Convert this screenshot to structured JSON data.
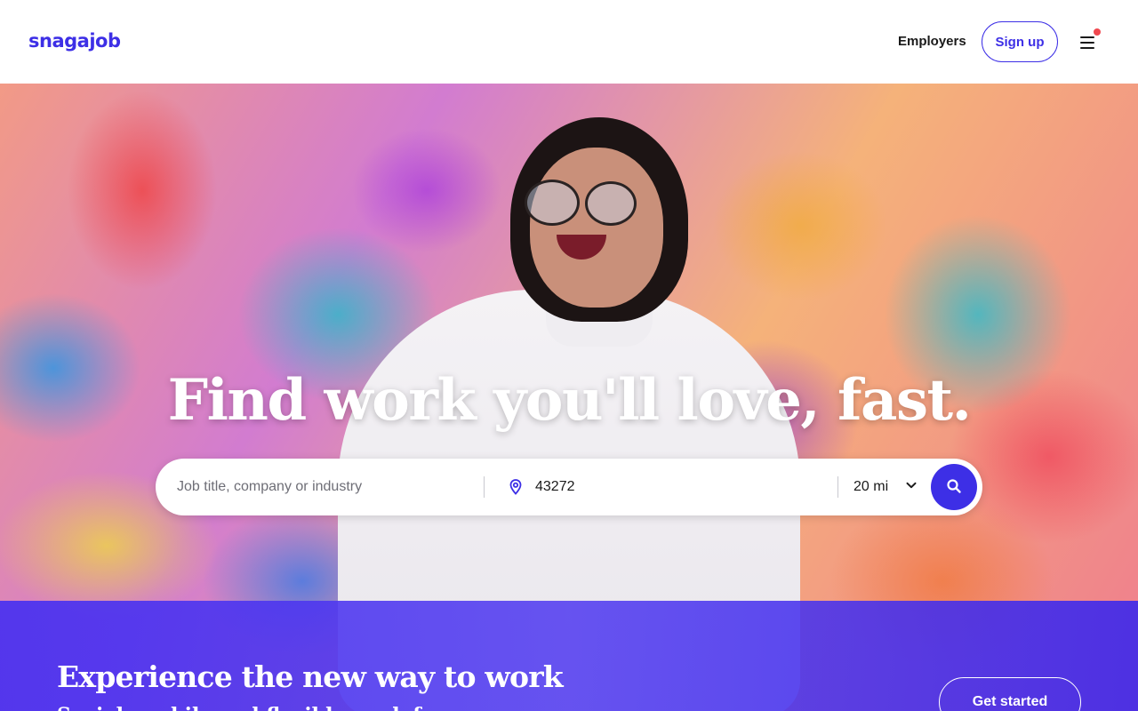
{
  "header": {
    "logo_text": "snagajob",
    "employers_label": "Employers",
    "signup_label": "Sign up",
    "menu_icon": "hamburger-menu-icon",
    "notification_dot_color": "#f0484f"
  },
  "hero": {
    "headline": "Find work you'll love, fast."
  },
  "search": {
    "job_placeholder": "Job title, company or industry",
    "job_value": "",
    "location_icon": "map-pin-icon",
    "location_value": "43272",
    "radius_value": "20 mi",
    "search_icon": "magnifier-icon"
  },
  "promo": {
    "title": "Experience the new way to work",
    "subtitle": "Social, mobile and flexible work for everyone",
    "cta_label": "Get started"
  },
  "colors": {
    "brand": "#3d2fe6",
    "promo_band": "#4830f0"
  }
}
